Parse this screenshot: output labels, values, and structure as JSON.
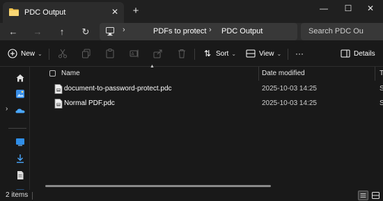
{
  "window": {
    "tab_title": "PDC Output",
    "tab_close": "✕",
    "new_tab": "+",
    "minimize": "—",
    "maximize": "☐",
    "close": "✕"
  },
  "nav": {
    "back": "←",
    "forward": "→",
    "up": "↑",
    "refresh": "↻"
  },
  "address": {
    "separator": "›",
    "crumbs": [
      "PDFs to protect",
      "PDC Output"
    ]
  },
  "search": {
    "placeholder": "Search PDC Ou"
  },
  "toolbar": {
    "new_label": "New",
    "sort_label": "Sort",
    "view_label": "View",
    "more_label": "···",
    "details_label": "Details",
    "chevron": "⌄"
  },
  "columns": {
    "name": "Name",
    "date_modified": "Date modified",
    "type": "T"
  },
  "files": [
    {
      "name": "document-to-password-protect.pdc",
      "date": "2025-10-03 14:25",
      "type": "S"
    },
    {
      "name": "Normal PDF.pdc",
      "date": "2025-10-03 14:25",
      "type": "S"
    }
  ],
  "status": {
    "item_count": "2 items"
  },
  "colors": {
    "accent": "#4cc2ff",
    "folder": "#f1c34d",
    "background": "#191919",
    "surface": "#2c2c2c"
  }
}
